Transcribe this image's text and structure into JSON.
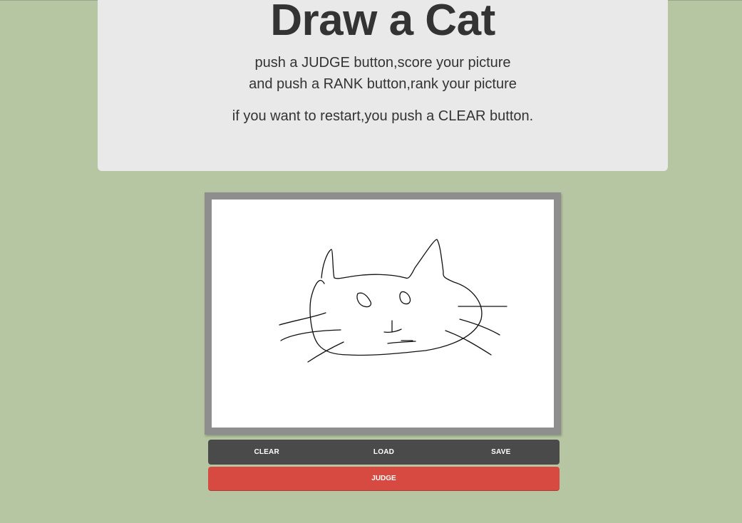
{
  "header": {
    "title": "Draw a Cat",
    "instruction_1": "push a JUDGE button,score your picture",
    "instruction_2": "and push a RANK button,rank your picture",
    "instruction_3": "if you want to restart,you push a CLEAR button."
  },
  "toolbar": {
    "clear_label": "CLEAR",
    "load_label": "LOAD",
    "save_label": "SAVE"
  },
  "judge": {
    "label": "JUDGE"
  },
  "colors": {
    "background": "#b6c6a2",
    "panel": "#e9e9e9",
    "toolbar": "#4a4a4a",
    "judge": "#d64a41"
  }
}
